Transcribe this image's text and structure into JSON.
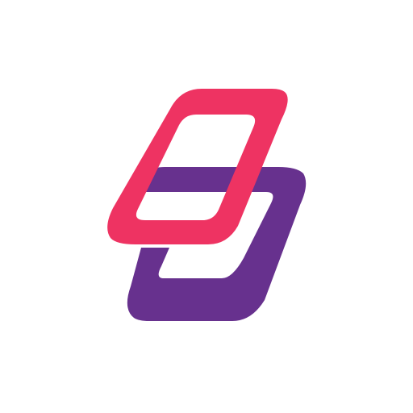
{
  "logo": {
    "name": "two-slanted-rounded-parallelograms",
    "colors": {
      "background": "#ffffff",
      "front_shape": "#EE3362",
      "back_shape": "#67318E"
    }
  }
}
